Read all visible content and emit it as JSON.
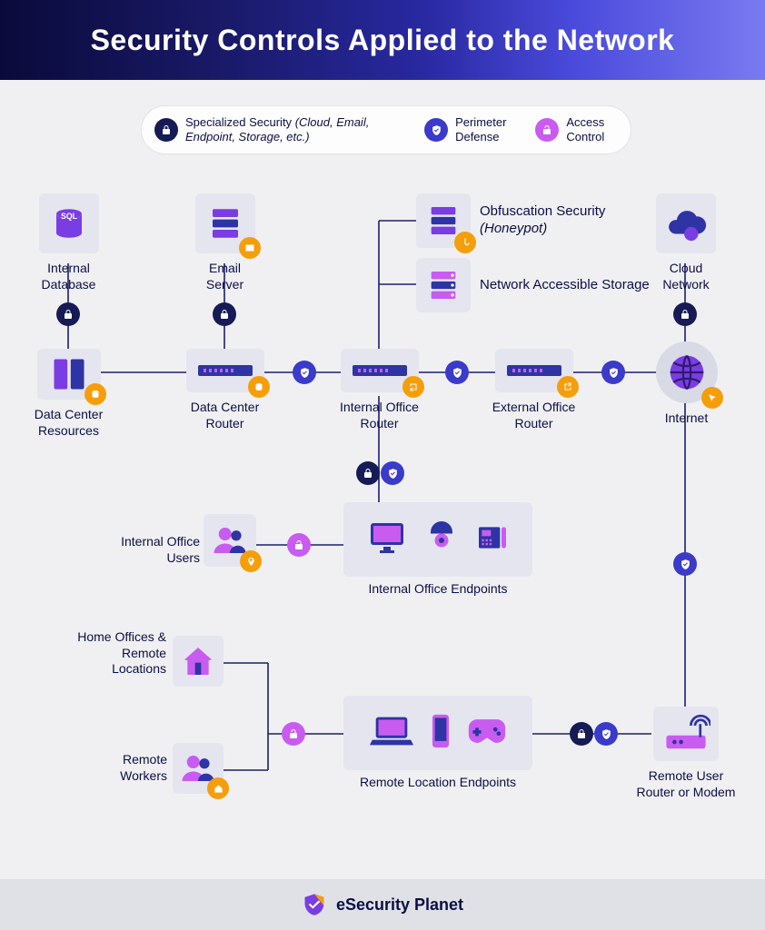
{
  "header": {
    "title": "Security Controls Applied to the Network"
  },
  "legend": {
    "specialized": {
      "label": "Specialized Security",
      "qualifier": "(Cloud, Email, Endpoint, Storage, etc.)"
    },
    "perimeter": {
      "label": "Perimeter Defense"
    },
    "access": {
      "label": "Access Control"
    }
  },
  "nodes": {
    "internal_database": "Internal Database",
    "email_server": "Email Server",
    "obfuscation": {
      "label": "Obfuscation Security",
      "qualifier": "(Honeypot)"
    },
    "nas": "Network Accessible Storage",
    "cloud_network": "Cloud Network",
    "data_center_resources": "Data Center Resources",
    "data_center_router": "Data Center Router",
    "internal_office_router": "Internal Office Router",
    "external_office_router": "External Office Router",
    "internet": "Internet",
    "internal_office_users": "Internal Office Users",
    "internal_office_endpoints": "Internal Office Endpoints",
    "home_offices": "Home Offices & Remote Locations",
    "remote_workers": "Remote Workers",
    "remote_location_endpoints": "Remote Location Endpoints",
    "remote_user_router": "Remote User Router or Modem"
  },
  "footer": {
    "brand": "eSecurity Planet"
  },
  "colors": {
    "navy": "#161b55",
    "blue": "#3a3acb",
    "pink": "#c85cf0",
    "orange": "#f59e0b",
    "purple": "#7a3ce3"
  }
}
